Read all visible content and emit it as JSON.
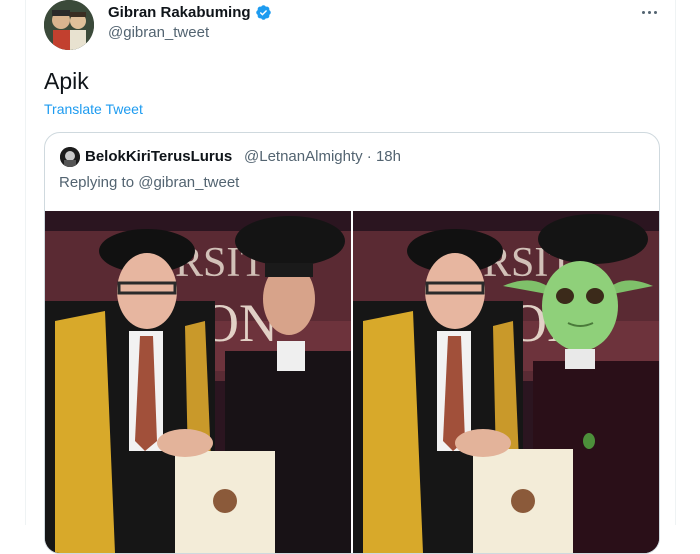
{
  "tweet": {
    "author_name": "Gibran Rakabuming",
    "author_handle": "@gibran_tweet",
    "text": "Apik",
    "translate_label": "Translate Tweet"
  },
  "quoted": {
    "author_name": "BelokKiriTerusLurus",
    "author_handle": "@LetnanAlmighty",
    "time": "18h",
    "reply_prefix": "Replying to",
    "reply_to": "@gibran_tweet",
    "photo_banner_text_left": "RSIT",
    "photo_banner_text_right": "RSIT",
    "photo_banner_text2_left": "ON",
    "photo_banner_text2_right": "ON"
  },
  "colors": {
    "link": "#1d9bf0",
    "secondary": "#536471",
    "verified": "#1d9bf0"
  },
  "icons": {
    "more": "more-horizontal-icon",
    "verified": "verified-badge-icon"
  }
}
